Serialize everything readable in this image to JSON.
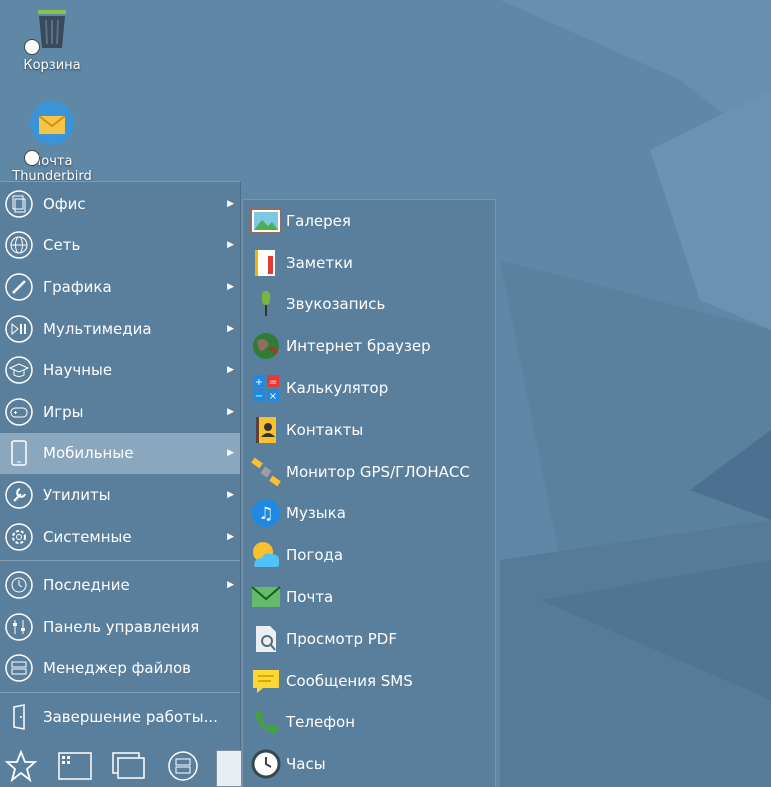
{
  "desktop": {
    "icons": [
      {
        "label": "Корзина",
        "icon": "trash-icon"
      },
      {
        "label": "Почта Thunderbird",
        "icon": "thunderbird-mail-icon"
      }
    ]
  },
  "main_menu": {
    "items": [
      {
        "label": "Офис",
        "icon": "office-icon",
        "submenu": true
      },
      {
        "label": "Сеть",
        "icon": "network-icon",
        "submenu": true
      },
      {
        "label": "Графика",
        "icon": "graphics-icon",
        "submenu": true
      },
      {
        "label": "Мультимедиа",
        "icon": "multimedia-icon",
        "submenu": true
      },
      {
        "label": "Научные",
        "icon": "science-icon",
        "submenu": true
      },
      {
        "label": "Игры",
        "icon": "games-icon",
        "submenu": true
      },
      {
        "label": "Мобильные",
        "icon": "mobile-icon",
        "submenu": true,
        "active": true
      },
      {
        "label": "Утилиты",
        "icon": "utilities-icon",
        "submenu": true
      },
      {
        "label": "Системные",
        "icon": "system-icon",
        "submenu": true
      }
    ],
    "items2": [
      {
        "label": "Последние",
        "icon": "recent-icon",
        "submenu": true
      },
      {
        "label": "Панель управления",
        "icon": "control-panel-icon",
        "submenu": false
      },
      {
        "label": "Менеджер файлов",
        "icon": "file-manager-icon",
        "submenu": false
      }
    ],
    "shutdown": {
      "label": "Завершение работы...",
      "icon": "exit-icon"
    }
  },
  "submenu": {
    "items": [
      {
        "label": "Галерея",
        "icon": "gallery-icon"
      },
      {
        "label": "Заметки",
        "icon": "notes-icon"
      },
      {
        "label": "Звукозапись",
        "icon": "microphone-icon"
      },
      {
        "label": "Интернет браузер",
        "icon": "browser-icon"
      },
      {
        "label": "Калькулятор",
        "icon": "calculator-icon"
      },
      {
        "label": "Контакты",
        "icon": "contacts-icon"
      },
      {
        "label": "Монитор GPS/ГЛОНАСС",
        "icon": "satellite-icon"
      },
      {
        "label": "Музыка",
        "icon": "music-icon"
      },
      {
        "label": "Погода",
        "icon": "weather-icon"
      },
      {
        "label": "Почта",
        "icon": "mail-icon"
      },
      {
        "label": "Просмотр PDF",
        "icon": "pdf-viewer-icon"
      },
      {
        "label": "Сообщения SMS",
        "icon": "sms-icon"
      },
      {
        "label": "Телефон",
        "icon": "phone-icon"
      },
      {
        "label": "Часы",
        "icon": "clock-icon"
      }
    ]
  },
  "taskbar": {
    "icons": [
      "start-star-icon",
      "app-grid-icon",
      "windows-icon",
      "drive-icon"
    ]
  },
  "colors": {
    "desktop": "#5f87a6",
    "menu": "#5a7f9c",
    "active": "#8aa7be"
  }
}
